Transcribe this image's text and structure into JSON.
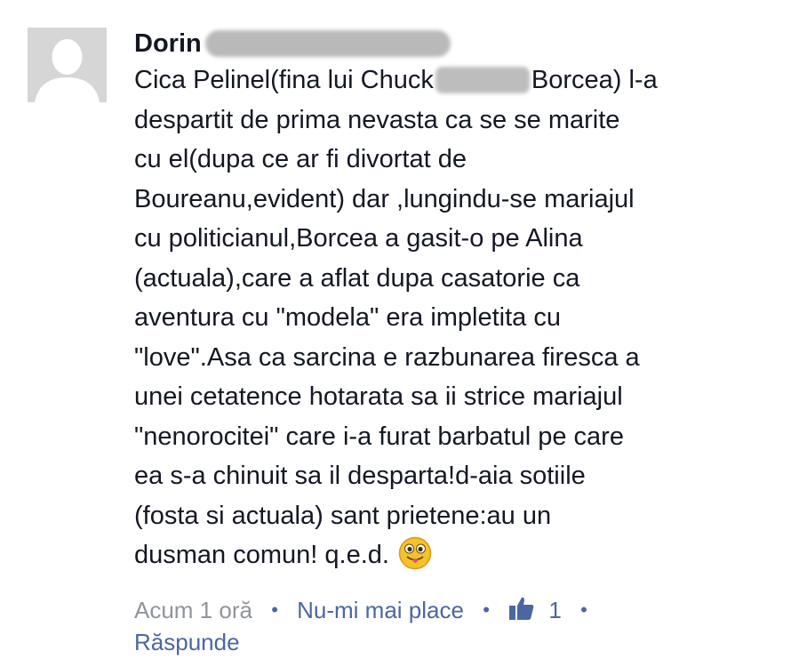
{
  "comment": {
    "author": "Dorin",
    "text_lines": [
      "Cica Pelinel(fina lui Chuck",
      "Borcea)  l-a",
      "despartit de prima nevasta ca se se marite",
      "cu el(dupa ce ar fi divortat de",
      "Boureanu,evident) dar ,lungindu-se mariajul",
      "cu politicianul,Borcea a gasit-o pe Alina",
      "(actuala),care a aflat dupa casatorie ca",
      "aventura cu \"modela\" era impletita cu",
      "\"love\".Asa ca sarcina e razbunarea firesca a",
      "unei cetatence hotarata sa ii strice mariajul",
      "\"nenorocitei\" care i-a furat barbatul pe care",
      "ea s-a chinuit sa il desparta!d-aia sotiile",
      "(fosta si actuala) sant prietene:au un",
      "dusman comun!  q.e.d."
    ],
    "emoji": "winking-tongue-emoji"
  },
  "meta": {
    "time": "Acum 1 oră",
    "unlike": "Nu-mi mai place",
    "like_count": "1",
    "reply": "Răspunde",
    "separator": "•"
  },
  "colors": {
    "text": "#141823",
    "link": "#4b67a1",
    "muted": "#90949c",
    "avatar_bg": "#d6d6d6"
  }
}
